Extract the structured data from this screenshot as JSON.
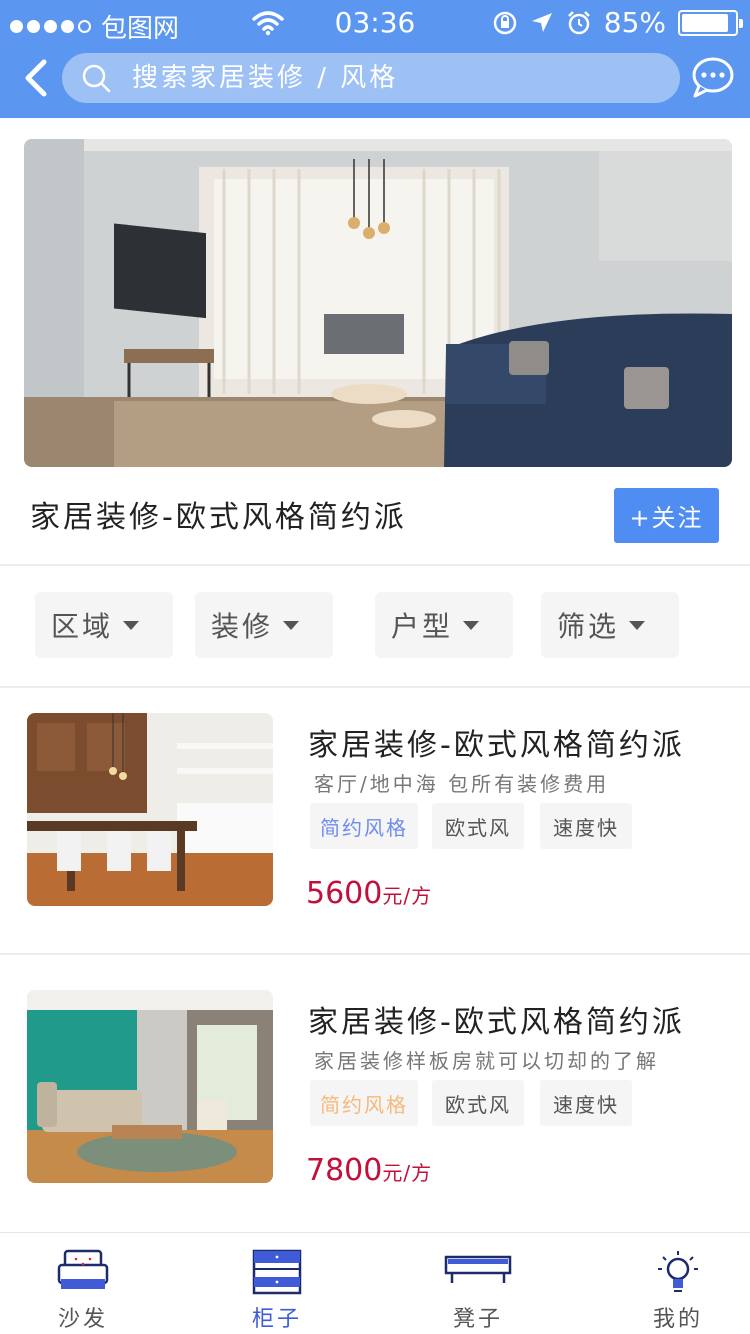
{
  "status_bar": {
    "carrier": "包图网",
    "time": "03:36",
    "battery": "85%"
  },
  "header": {
    "search_placeholder": "搜索家居装修 / 风格"
  },
  "hero": {
    "title": "家居装修-欧式风格简约派",
    "follow_label": "+关注"
  },
  "filters": [
    {
      "label": "区域"
    },
    {
      "label": "装修"
    },
    {
      "label": "户型"
    },
    {
      "label": "筛选"
    }
  ],
  "listings": [
    {
      "title": "家居装修-欧式风格简约派",
      "subtitle": "客厅/地中海  包所有装修费用",
      "tags": [
        "简约风格",
        "欧式风",
        "速度快"
      ],
      "tag_accent_color": "#6e8cf0",
      "price": "5600",
      "unit": "元/方"
    },
    {
      "title": "家居装修-欧式风格简约派",
      "subtitle": "家居装修样板房就可以切却的了解",
      "tags": [
        "简约风格",
        "欧式风",
        "速度快"
      ],
      "tag_accent_color": "#f5b97a",
      "price": "7800",
      "unit": "元/方"
    }
  ],
  "tabs": [
    {
      "label": "沙发",
      "icon": "sofa-icon"
    },
    {
      "label": "柜子",
      "icon": "cabinet-icon"
    },
    {
      "label": "凳子",
      "icon": "bench-icon"
    },
    {
      "label": "我的",
      "icon": "lightbulb-icon"
    }
  ],
  "colors": {
    "header_bg": "#5b97f0",
    "accent": "#4f8df2",
    "price": "#c3103a",
    "active_tab": "#3f5bd8"
  }
}
